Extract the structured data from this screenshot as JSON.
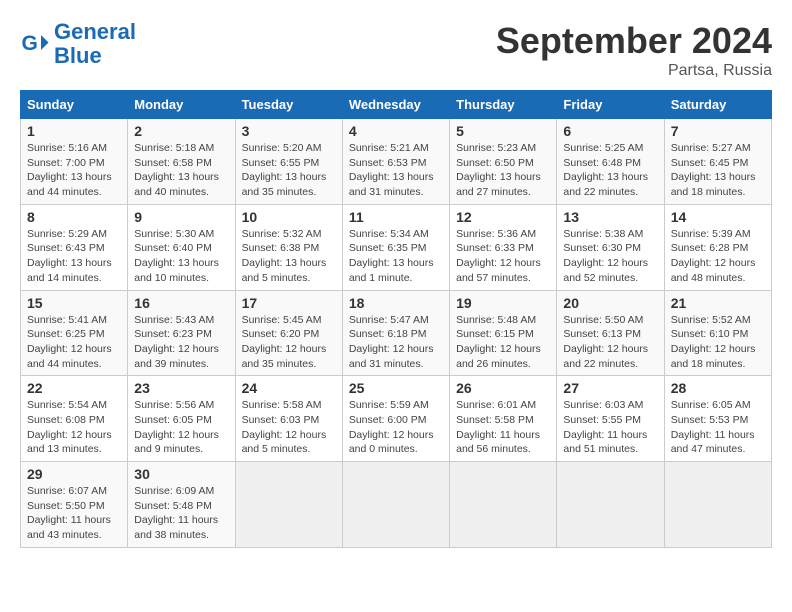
{
  "header": {
    "logo_line1": "General",
    "logo_line2": "Blue",
    "month": "September 2024",
    "location": "Partsa, Russia"
  },
  "weekdays": [
    "Sunday",
    "Monday",
    "Tuesday",
    "Wednesday",
    "Thursday",
    "Friday",
    "Saturday"
  ],
  "weeks": [
    [
      {
        "day": "1",
        "info": "Sunrise: 5:16 AM\nSunset: 7:00 PM\nDaylight: 13 hours\nand 44 minutes."
      },
      {
        "day": "2",
        "info": "Sunrise: 5:18 AM\nSunset: 6:58 PM\nDaylight: 13 hours\nand 40 minutes."
      },
      {
        "day": "3",
        "info": "Sunrise: 5:20 AM\nSunset: 6:55 PM\nDaylight: 13 hours\nand 35 minutes."
      },
      {
        "day": "4",
        "info": "Sunrise: 5:21 AM\nSunset: 6:53 PM\nDaylight: 13 hours\nand 31 minutes."
      },
      {
        "day": "5",
        "info": "Sunrise: 5:23 AM\nSunset: 6:50 PM\nDaylight: 13 hours\nand 27 minutes."
      },
      {
        "day": "6",
        "info": "Sunrise: 5:25 AM\nSunset: 6:48 PM\nDaylight: 13 hours\nand 22 minutes."
      },
      {
        "day": "7",
        "info": "Sunrise: 5:27 AM\nSunset: 6:45 PM\nDaylight: 13 hours\nand 18 minutes."
      }
    ],
    [
      {
        "day": "8",
        "info": "Sunrise: 5:29 AM\nSunset: 6:43 PM\nDaylight: 13 hours\nand 14 minutes."
      },
      {
        "day": "9",
        "info": "Sunrise: 5:30 AM\nSunset: 6:40 PM\nDaylight: 13 hours\nand 10 minutes."
      },
      {
        "day": "10",
        "info": "Sunrise: 5:32 AM\nSunset: 6:38 PM\nDaylight: 13 hours\nand 5 minutes."
      },
      {
        "day": "11",
        "info": "Sunrise: 5:34 AM\nSunset: 6:35 PM\nDaylight: 13 hours\nand 1 minute."
      },
      {
        "day": "12",
        "info": "Sunrise: 5:36 AM\nSunset: 6:33 PM\nDaylight: 12 hours\nand 57 minutes."
      },
      {
        "day": "13",
        "info": "Sunrise: 5:38 AM\nSunset: 6:30 PM\nDaylight: 12 hours\nand 52 minutes."
      },
      {
        "day": "14",
        "info": "Sunrise: 5:39 AM\nSunset: 6:28 PM\nDaylight: 12 hours\nand 48 minutes."
      }
    ],
    [
      {
        "day": "15",
        "info": "Sunrise: 5:41 AM\nSunset: 6:25 PM\nDaylight: 12 hours\nand 44 minutes."
      },
      {
        "day": "16",
        "info": "Sunrise: 5:43 AM\nSunset: 6:23 PM\nDaylight: 12 hours\nand 39 minutes."
      },
      {
        "day": "17",
        "info": "Sunrise: 5:45 AM\nSunset: 6:20 PM\nDaylight: 12 hours\nand 35 minutes."
      },
      {
        "day": "18",
        "info": "Sunrise: 5:47 AM\nSunset: 6:18 PM\nDaylight: 12 hours\nand 31 minutes."
      },
      {
        "day": "19",
        "info": "Sunrise: 5:48 AM\nSunset: 6:15 PM\nDaylight: 12 hours\nand 26 minutes."
      },
      {
        "day": "20",
        "info": "Sunrise: 5:50 AM\nSunset: 6:13 PM\nDaylight: 12 hours\nand 22 minutes."
      },
      {
        "day": "21",
        "info": "Sunrise: 5:52 AM\nSunset: 6:10 PM\nDaylight: 12 hours\nand 18 minutes."
      }
    ],
    [
      {
        "day": "22",
        "info": "Sunrise: 5:54 AM\nSunset: 6:08 PM\nDaylight: 12 hours\nand 13 minutes."
      },
      {
        "day": "23",
        "info": "Sunrise: 5:56 AM\nSunset: 6:05 PM\nDaylight: 12 hours\nand 9 minutes."
      },
      {
        "day": "24",
        "info": "Sunrise: 5:58 AM\nSunset: 6:03 PM\nDaylight: 12 hours\nand 5 minutes."
      },
      {
        "day": "25",
        "info": "Sunrise: 5:59 AM\nSunset: 6:00 PM\nDaylight: 12 hours\nand 0 minutes."
      },
      {
        "day": "26",
        "info": "Sunrise: 6:01 AM\nSunset: 5:58 PM\nDaylight: 11 hours\nand 56 minutes."
      },
      {
        "day": "27",
        "info": "Sunrise: 6:03 AM\nSunset: 5:55 PM\nDaylight: 11 hours\nand 51 minutes."
      },
      {
        "day": "28",
        "info": "Sunrise: 6:05 AM\nSunset: 5:53 PM\nDaylight: 11 hours\nand 47 minutes."
      }
    ],
    [
      {
        "day": "29",
        "info": "Sunrise: 6:07 AM\nSunset: 5:50 PM\nDaylight: 11 hours\nand 43 minutes."
      },
      {
        "day": "30",
        "info": "Sunrise: 6:09 AM\nSunset: 5:48 PM\nDaylight: 11 hours\nand 38 minutes."
      },
      {
        "day": "",
        "info": ""
      },
      {
        "day": "",
        "info": ""
      },
      {
        "day": "",
        "info": ""
      },
      {
        "day": "",
        "info": ""
      },
      {
        "day": "",
        "info": ""
      }
    ]
  ]
}
